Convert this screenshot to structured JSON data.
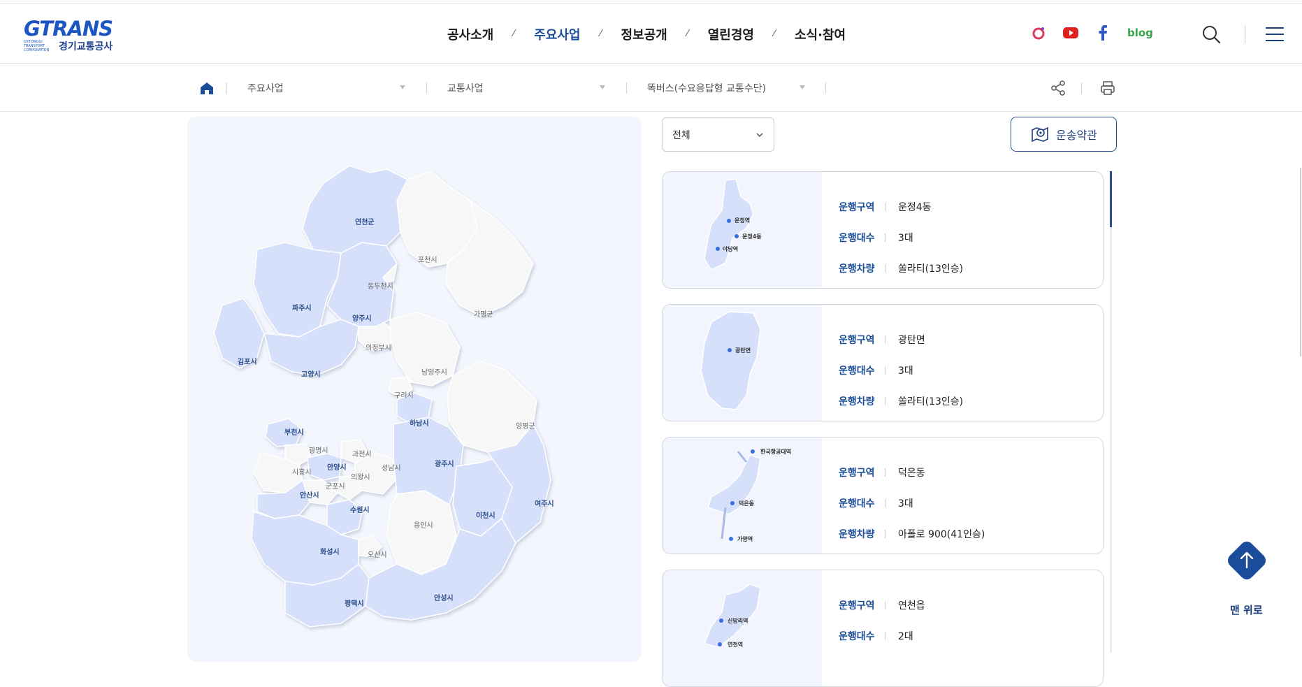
{
  "logo": {
    "brand": "GTRANS",
    "corp": "GYEONGGI TRANSPORT CORPORATION",
    "name_kr": "경기교통공사"
  },
  "nav": [
    {
      "label": "공사소개",
      "active": false
    },
    {
      "label": "주요사업",
      "active": true
    },
    {
      "label": "정보공개",
      "active": false
    },
    {
      "label": "열린경영",
      "active": false
    },
    {
      "label": "소식·참여",
      "active": false
    }
  ],
  "nav_sep": "⁄",
  "social": {
    "blog": "blog"
  },
  "breadcrumb": {
    "level1": "주요사업",
    "level2": "교통사업",
    "level3": "똑버스(수요응답형 교통수단)"
  },
  "map": {
    "labels": {
      "yeoncheon": "연천군",
      "pocheon": "포천시",
      "dongducheon": "동두천시",
      "paju": "파주시",
      "yangju": "양주시",
      "gapyeong": "가평군",
      "uijeongbu": "의정부시",
      "gimpo": "김포시",
      "goyang": "고양시",
      "namyangju": "남양주시",
      "guri": "구리시",
      "hanam": "하남시",
      "yangpyeong": "양평군",
      "bucheon": "부천시",
      "gwangmyeong": "광명시",
      "gwacheon": "과천시",
      "siheung": "시흥시",
      "anyang": "안양시",
      "seongnam": "성남시",
      "gwangju": "광주시",
      "uiwang": "의왕시",
      "gunpo": "군포시",
      "ansan": "안산시",
      "suwon": "수원시",
      "yongin": "용인시",
      "icheon": "이천시",
      "yeoju": "여주시",
      "hwaseong": "화성시",
      "osan": "오산시",
      "pyeongtaek": "평택시",
      "anseong": "안성시"
    }
  },
  "filter": {
    "selected": "전체"
  },
  "terms_button": "운송약관",
  "cards": [
    {
      "area_label": "운행구역",
      "area": "운정4동",
      "count_label": "운행대수",
      "count": "3대",
      "vehicle_label": "운행차량",
      "vehicle": "쏠라티(13인승)",
      "stops": [
        "운정역",
        "운정4동",
        "야당역"
      ]
    },
    {
      "area_label": "운행구역",
      "area": "광탄면",
      "count_label": "운행대수",
      "count": "3대",
      "vehicle_label": "운행차량",
      "vehicle": "쏠라티(13인승)",
      "stops": [
        "광탄면"
      ]
    },
    {
      "area_label": "운행구역",
      "area": "덕은동",
      "count_label": "운행대수",
      "count": "3대",
      "vehicle_label": "운행차량",
      "vehicle": "아폴로 900(41인승)",
      "stops": [
        "한국항공대역",
        "덕은동",
        "가양역"
      ]
    },
    {
      "area_label": "운행구역",
      "area": "연천읍",
      "count_label": "운행대수",
      "count": "2대",
      "stops": [
        "신망리역",
        "연천역"
      ]
    }
  ],
  "top_button": "맨 위로",
  "colors": {
    "accent": "#1c4e98",
    "region_active": "#d6e0fa",
    "region_inactive": "#f7f7f7",
    "top_button": "#1b4b9b"
  }
}
